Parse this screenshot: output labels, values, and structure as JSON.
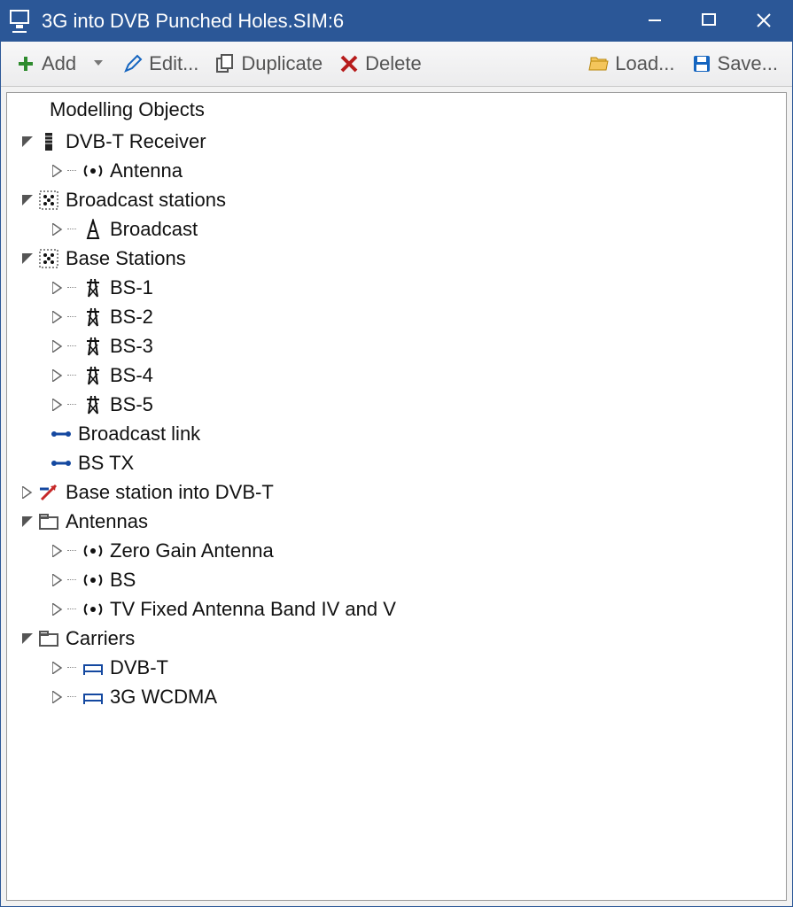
{
  "titlebar": {
    "title": "3G into DVB Punched Holes.SIM:6"
  },
  "toolbar": {
    "add": "Add",
    "edit": "Edit...",
    "duplicate": "Duplicate",
    "delete": "Delete",
    "load": "Load...",
    "save": "Save..."
  },
  "tree": {
    "header": "Modelling Objects",
    "dvbt_receiver": "DVB-T Receiver",
    "dvbt_receiver_antenna": "Antenna",
    "broadcast_stations": "Broadcast stations",
    "broadcast_stations_broadcast": "Broadcast",
    "base_stations": "Base Stations",
    "bs1": "BS-1",
    "bs2": "BS-2",
    "bs3": "BS-3",
    "bs4": "BS-4",
    "bs5": "BS-5",
    "broadcast_link": "Broadcast link",
    "bs_tx": "BS TX",
    "bs_into_dvbt": "Base station into DVB-T",
    "antennas": "Antennas",
    "ant_zero_gain": "Zero Gain Antenna",
    "ant_bs": "BS",
    "ant_tv_fixed": "TV Fixed Antenna Band IV and V",
    "carriers": "Carriers",
    "carrier_dvbt": "DVB-T",
    "carrier_3g": "3G WCDMA"
  }
}
